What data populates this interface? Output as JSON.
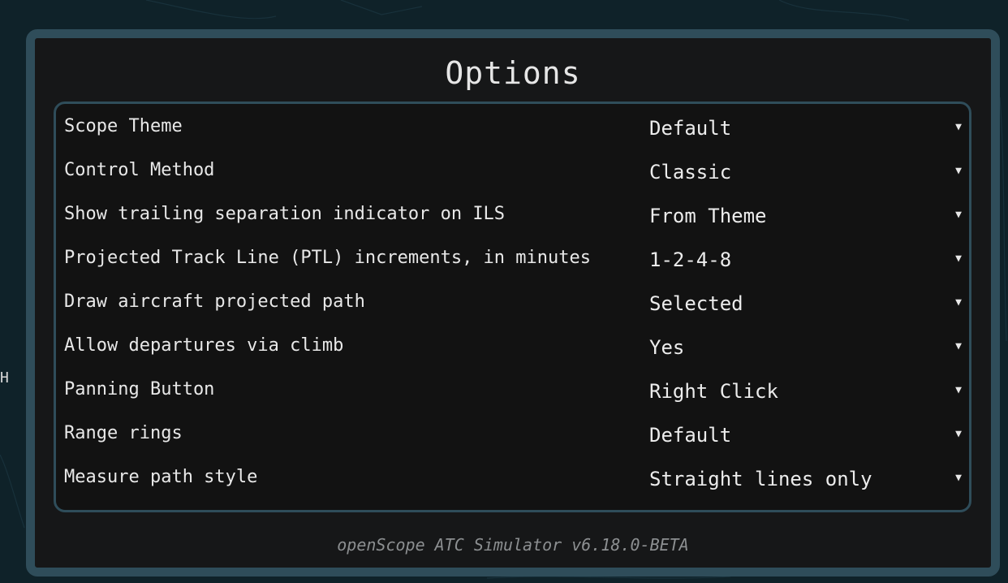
{
  "background": {
    "edge_letter": "H"
  },
  "dialog": {
    "title": "Options",
    "options": [
      {
        "label": "Scope Theme",
        "value": "Default"
      },
      {
        "label": "Control Method",
        "value": "Classic"
      },
      {
        "label": "Show trailing separation indicator on ILS",
        "value": "From Theme"
      },
      {
        "label": "Projected Track Line (PTL) increments, in minutes",
        "value": "1-2-4-8"
      },
      {
        "label": "Draw aircraft projected path",
        "value": "Selected"
      },
      {
        "label": "Allow departures via climb",
        "value": "Yes"
      },
      {
        "label": "Panning Button",
        "value": "Right Click"
      },
      {
        "label": "Range rings",
        "value": "Default"
      },
      {
        "label": "Measure path style",
        "value": "Straight lines only"
      }
    ],
    "dropdown_icon": "▼",
    "footer": "openScope ATC Simulator v6.18.0-BETA"
  },
  "colors": {
    "background": "#0f2229",
    "dialog_border": "#2f4d5a",
    "dialog_fill": "#161718",
    "panel_fill": "#121212",
    "text": "#e8e8e8",
    "footer_text": "#8c8f91"
  }
}
